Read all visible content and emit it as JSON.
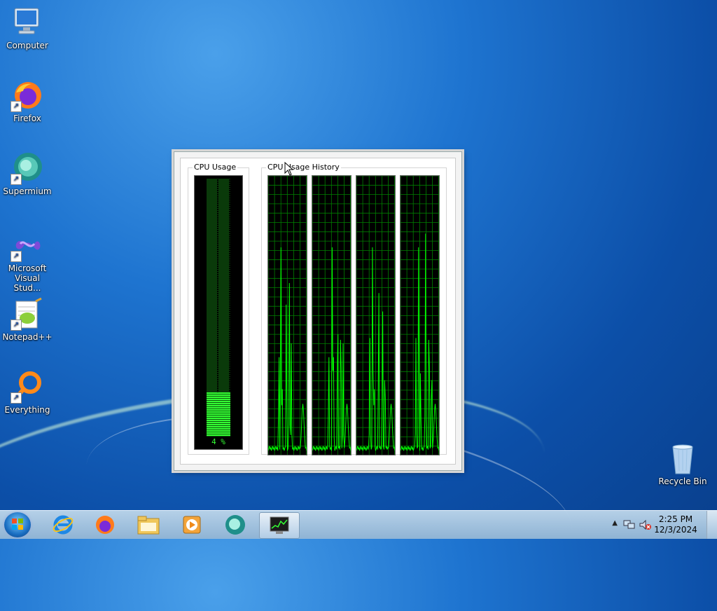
{
  "desktop": {
    "icons": [
      {
        "label": "Computer",
        "icon": "computer-icon"
      },
      {
        "label": "Firefox",
        "icon": "firefox-icon"
      },
      {
        "label": "Supermium",
        "icon": "supermium-icon"
      },
      {
        "label_line1": "Microsoft",
        "label_line2": "Visual Stud...",
        "icon": "visual-studio-icon"
      },
      {
        "label": "Notepad++",
        "icon": "notepadpp-icon"
      },
      {
        "label": "Everything",
        "icon": "everything-icon"
      },
      {
        "label": "Recycle Bin",
        "icon": "recycle-bin-icon"
      }
    ]
  },
  "cpu_gadget": {
    "usage_label": "CPU Usage",
    "history_label": "CPU Usage History",
    "usage_value": "4 %",
    "usage_percent": 4,
    "core_count": 4,
    "colors": {
      "graph_line": "#00ff00",
      "grid": "#008000",
      "background": "#000000"
    }
  },
  "taskbar": {
    "pinned": [
      "start-orb",
      "internet-explorer-icon",
      "firefox-icon",
      "file-explorer-icon",
      "media-player-icon",
      "supermium-icon",
      "task-manager-icon"
    ],
    "active": "task-manager-icon",
    "clock_time": "2:25 PM",
    "clock_date": "12/3/2024"
  }
}
